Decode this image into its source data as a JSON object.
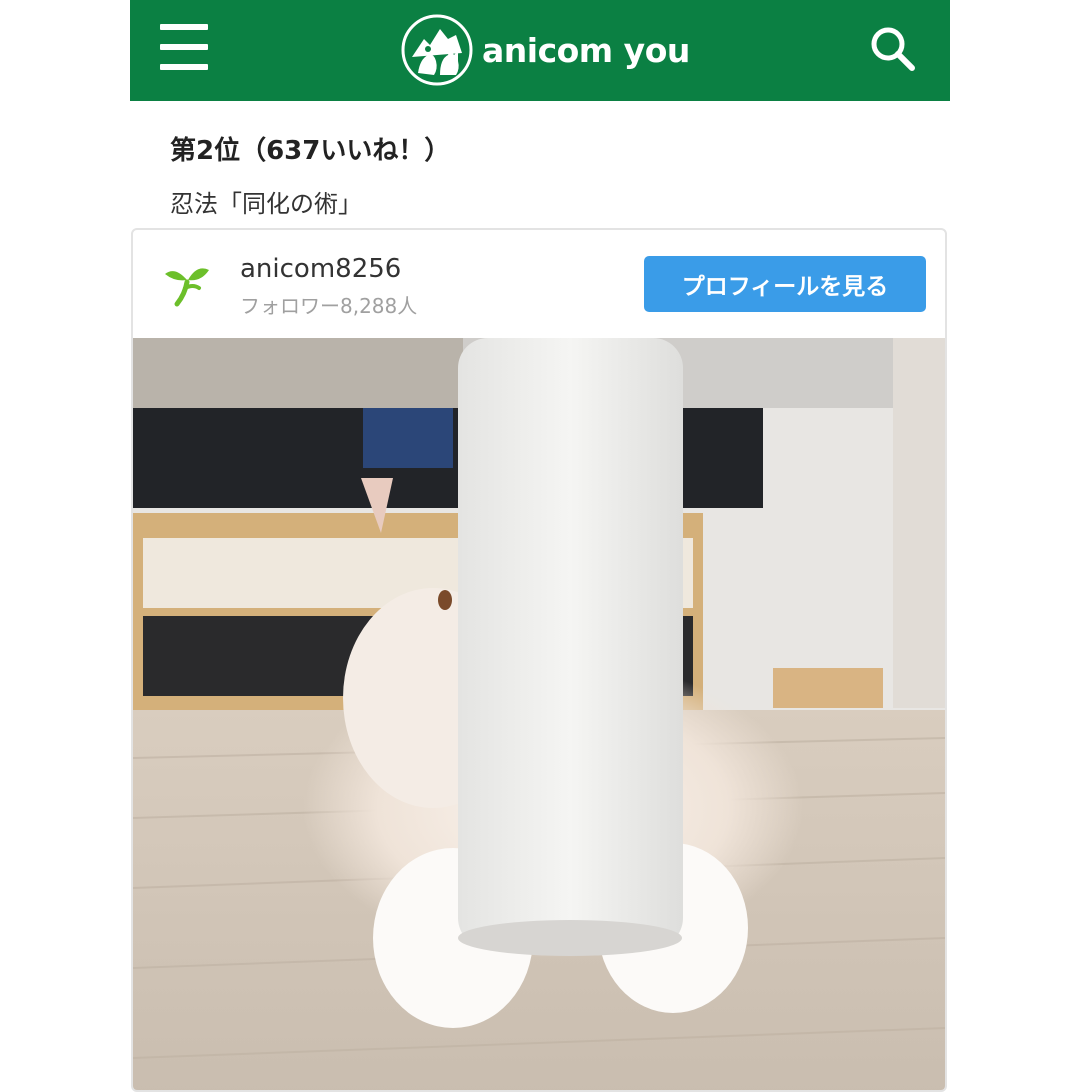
{
  "header": {
    "brand": "anicom you",
    "menu_icon": "hamburger-menu-icon",
    "search_icon": "search-icon",
    "color": "#0b8043"
  },
  "post": {
    "rank_title": "第2位（637いいね！）",
    "caption": "忍法「同化の術」"
  },
  "card": {
    "username": "anicom8256",
    "followers": "フォロワー8,288人",
    "profile_button": "プロフィールを見る",
    "button_color": "#3a9ce8"
  }
}
